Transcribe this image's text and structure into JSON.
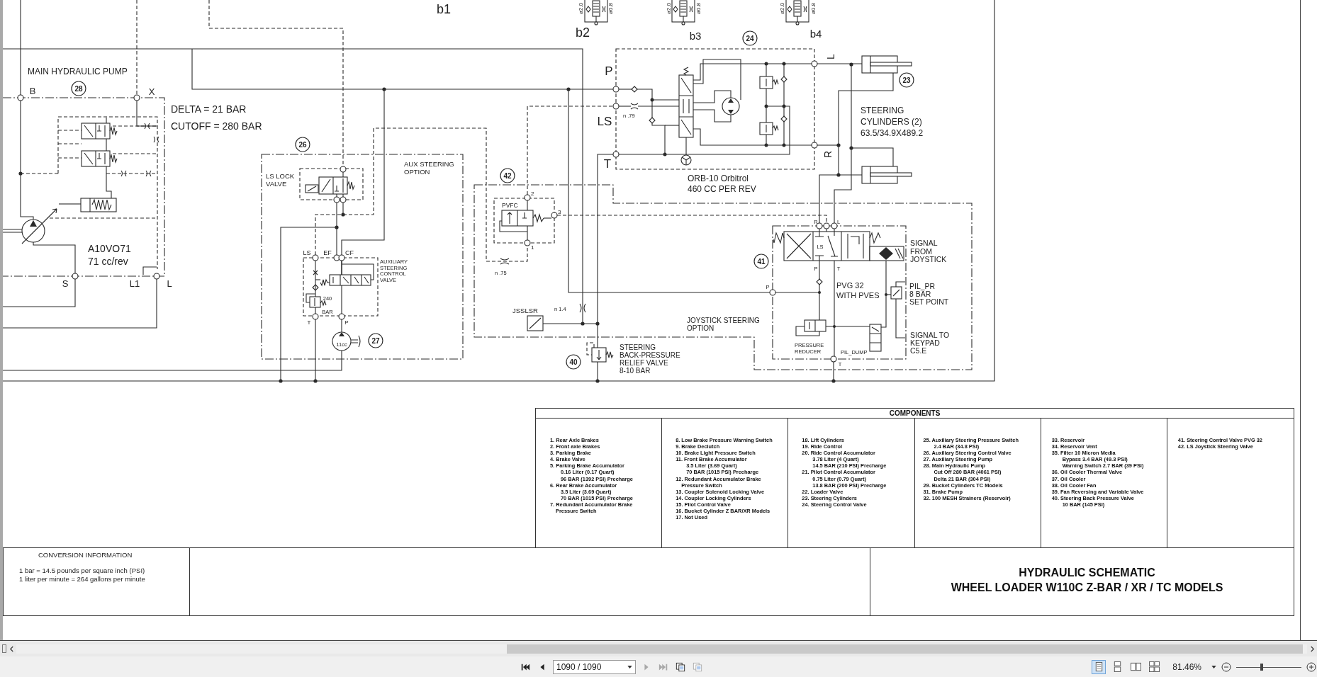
{
  "schematic": {
    "labels": [
      {
        "lines": [
          "b1"
        ]
      },
      {
        "lines": [
          "ø2.0"
        ]
      },
      {
        "lines": [
          "ø0.8"
        ]
      },
      {
        "lines": [
          "ø2.0"
        ]
      },
      {
        "lines": [
          "ø0.8"
        ]
      },
      {
        "lines": [
          "ø2.0"
        ]
      },
      {
        "lines": [
          "ø0.8"
        ]
      },
      {
        "lines": [
          "b2"
        ]
      },
      {
        "lines": [
          "b3"
        ]
      },
      {
        "lines": [
          "b4"
        ]
      },
      {
        "lines": [
          "L"
        ]
      },
      {
        "lines": [
          "MAIN HYDRAULIC PUMP"
        ]
      },
      {
        "lines": [
          "P"
        ]
      },
      {
        "lines": [
          "B"
        ]
      },
      {
        "lines": [
          "X"
        ]
      },
      {
        "lines": [
          "DELTA = 21 BAR"
        ]
      },
      {
        "lines": [
          "CUTOFF = 280 BAR"
        ]
      },
      {
        "lines": [
          "LS"
        ]
      },
      {
        "lines": [
          "n .79"
        ]
      },
      {
        "lines": [
          "STEERING",
          "CYLINDERS (2)",
          "63.5/34.9X489.2"
        ]
      },
      {
        "lines": [
          "LS LOCK",
          "VALVE"
        ]
      },
      {
        "lines": [
          "AUX STEERING",
          "OPTION"
        ]
      },
      {
        "lines": [
          "T"
        ]
      },
      {
        "lines": [
          "R"
        ]
      },
      {
        "lines": [
          "2"
        ]
      },
      {
        "lines": [
          "ORB-10 Orbitrol",
          "460 CC PER REV"
        ]
      },
      {
        "lines": [
          "PVFC"
        ]
      },
      {
        "lines": [
          "3"
        ]
      },
      {
        "lines": [
          "R"
        ]
      },
      {
        "lines": [
          "L"
        ]
      },
      {
        "lines": [
          "A10VO71",
          "71 cc/rev"
        ]
      },
      {
        "lines": [
          "LS"
        ]
      },
      {
        "lines": [
          "EF"
        ]
      },
      {
        "lines": [
          "CF"
        ]
      },
      {
        "lines": [
          "1"
        ]
      },
      {
        "lines": [
          "LS"
        ]
      },
      {
        "lines": [
          "S"
        ]
      },
      {
        "lines": [
          "L1"
        ]
      },
      {
        "lines": [
          "L"
        ]
      },
      {
        "lines": [
          "AUXILIARY",
          "STEERING",
          "CONTROL",
          "VALVE"
        ]
      },
      {
        "lines": [
          "SIGNAL",
          "FROM",
          "JOYSTICK"
        ]
      },
      {
        "lines": [
          "n .75"
        ]
      },
      {
        "lines": [
          "P"
        ]
      },
      {
        "lines": [
          "T"
        ]
      },
      {
        "lines": [
          "240"
        ]
      },
      {
        "lines": [
          "P"
        ]
      },
      {
        "lines": [
          "PVG 32",
          "WITH PVES"
        ]
      },
      {
        "lines": [
          "PIL_PR",
          "8 BAR",
          "SET POINT"
        ]
      },
      {
        "lines": [
          "BAR"
        ]
      },
      {
        "lines": [
          "JSSLSR"
        ]
      },
      {
        "lines": [
          "n 1.4"
        ]
      },
      {
        "lines": [
          "T"
        ]
      },
      {
        "lines": [
          "P"
        ]
      },
      {
        "lines": [
          "JOYSTICK STEERING",
          "OPTION"
        ]
      },
      {
        "lines": [
          "STEERING",
          "BACK-PRESSURE",
          "RELIEF VALVE",
          "8-10 BAR"
        ]
      },
      {
        "lines": [
          "PRESSURE",
          "REDUCER"
        ]
      },
      {
        "lines": [
          "PIL_DUMP"
        ]
      },
      {
        "lines": [
          "SIGNAL TO",
          "KEYPAD",
          "C5.E"
        ]
      },
      {
        "lines": [
          "T"
        ]
      }
    ],
    "callouts": [
      "24",
      "28",
      "23",
      "26",
      "42",
      "41",
      "27",
      "40"
    ],
    "aux_pump": {
      "label": "11cc"
    }
  },
  "components": {
    "title": "COMPONENTS",
    "columns": [
      {
        "entries": [
          {
            "lines": [
              "1. Rear Axle Brakes"
            ]
          },
          {
            "lines": [
              "2. Front axle Brakes"
            ]
          },
          {
            "lines": [
              "3. Parking Brake"
            ]
          },
          {
            "lines": [
              "4. Brake Valve"
            ]
          },
          {
            "lines": [
              "5. Parking Brake Accumulator"
            ],
            "children": [
              {
                "lines": [
                  "0.16 Liter (0.17 Quart)"
                ]
              },
              {
                "lines": [
                  "96 BAR (1392 PSI) Precharge"
                ]
              }
            ]
          },
          {
            "lines": [
              "6. Rear Brake Accumulator"
            ],
            "children": [
              {
                "lines": [
                  "3.5 Liter (3.69 Quart)"
                ]
              },
              {
                "lines": [
                  "70 BAR (1015 PSI) Precharge"
                ]
              }
            ]
          },
          {
            "lines": [
              "7. Redundant Accumulator Brake",
              "Pressure Switch"
            ]
          }
        ]
      },
      {
        "entries": [
          {
            "lines": [
              "8. Low Brake Pressure Warning Switch"
            ]
          },
          {
            "lines": [
              "9. Brake Declutch"
            ]
          },
          {
            "lines": [
              "10. Brake Light Pressure Switch"
            ]
          },
          {
            "lines": [
              "11. Front Brake Accumulator"
            ],
            "children": [
              {
                "lines": [
                  "3.5 Liter (3.69 Quart)"
                ]
              },
              {
                "lines": [
                  "70 BAR (1015 PSI) Precharge"
                ]
              }
            ]
          },
          {
            "lines": [
              "12. Redundant Accumulator Brake",
              "Pressure Switch"
            ]
          },
          {
            "lines": [
              "13. Coupler Solenoid Locking Valve"
            ]
          },
          {
            "lines": [
              "14. Coupler Locking Cylinders"
            ]
          },
          {
            "lines": [
              "15. Pilot Control Valve"
            ]
          },
          {
            "lines": [
              "16. Bucket Cylinder Z BAR/XR Models"
            ]
          },
          {
            "lines": [
              "17. Not Used"
            ]
          }
        ]
      },
      {
        "entries": [
          {
            "lines": [
              "18. Lift Cylinders"
            ]
          },
          {
            "lines": [
              "19. Ride Control"
            ]
          },
          {
            "lines": [
              "20. Ride Control Accumulator"
            ],
            "children": [
              {
                "lines": [
                  "3.78 Liter (4 Quart)"
                ]
              },
              {
                "lines": [
                  "14.5 BAR (210 PSI) Precharge"
                ]
              }
            ]
          },
          {
            "lines": [
              "21. Pilot Control Accumulator"
            ],
            "children": [
              {
                "lines": [
                  "0.75 Liter (0.79 Quart)"
                ]
              },
              {
                "lines": [
                  "13.8 BAR (200 PSI) Precharge"
                ]
              }
            ]
          },
          {
            "lines": [
              "22. Loader Valve"
            ]
          },
          {
            "lines": [
              "23. Steering Cylinders"
            ]
          },
          {
            "lines": [
              "24. Steering Control Valve"
            ]
          }
        ]
      },
      {
        "entries": [
          {
            "lines": [
              "25. Auxiliary Steering Pressure Switch"
            ],
            "children": [
              {
                "lines": [
                  "2.4 BAR (34.8 PSI)"
                ]
              }
            ]
          },
          {
            "lines": [
              "26. Auxiliary Steering Control Valve"
            ]
          },
          {
            "lines": [
              "27. Auxiliary Steering Pump"
            ]
          },
          {
            "lines": [
              "28. Main Hydraulic Pump"
            ],
            "children": [
              {
                "lines": [
                  "Cut Off 280 BAR (4061 PSI)"
                ]
              },
              {
                "lines": [
                  "Delta 21 BAR (304 PSI)"
                ]
              }
            ]
          },
          {
            "lines": [
              "29. Bucket Cylinders TC Models"
            ]
          },
          {
            "lines": [
              "31. Brake Pump"
            ]
          },
          {
            "lines": [
              "32. 100 MESH Strainers (Reservoir)"
            ]
          }
        ]
      },
      {
        "entries": [
          {
            "lines": [
              "33. Reservoir"
            ]
          },
          {
            "lines": [
              "34. Reservoir Vent"
            ]
          },
          {
            "lines": [
              "35. Filter 10 Micron Media"
            ],
            "children": [
              {
                "lines": [
                  "Bypass 3.4 BAR (49.3 PSI)"
                ]
              },
              {
                "lines": [
                  "Warning Switch 2.7 BAR (39 PSI)"
                ]
              }
            ]
          },
          {
            "lines": [
              "36. Oil Cooler Thermal Valve"
            ]
          },
          {
            "lines": [
              "37. Oil Cooler"
            ]
          },
          {
            "lines": [
              "38. Oil Cooler Fan"
            ]
          },
          {
            "lines": [
              "39. Fan Reversing and Variable Valve"
            ]
          },
          {
            "lines": [
              "40. Steering Back Pressure Valve"
            ],
            "children": [
              {
                "lines": [
                  "10 BAR (145 PSI)"
                ]
              }
            ]
          }
        ]
      },
      {
        "entries": [
          {
            "lines": [
              "41. Steering Control Valve PVG 32"
            ]
          },
          {
            "lines": [
              "42. LS Joystick Steering Valve"
            ]
          }
        ]
      }
    ]
  },
  "conversion": {
    "title": "CONVERSION INFORMATION",
    "lines": [
      "1 bar = 14.5 pounds per square inch (PSI)",
      "1 liter per minute = 264 gallons per minute"
    ]
  },
  "title_block": {
    "lines": [
      "HYDRAULIC SCHEMATIC",
      "WHEEL LOADER W110C Z-BAR / XR / TC MODELS"
    ]
  },
  "viewer": {
    "nav_buttons": [
      {
        "kind": "first",
        "disabled": false
      },
      {
        "kind": "previous",
        "disabled": false
      },
      {
        "kind": "next",
        "disabled": true
      },
      {
        "kind": "last",
        "disabled": true
      }
    ],
    "page_field": "1090 / 1090",
    "page_tools": [
      {
        "disabled": false
      },
      {
        "disabled": true
      }
    ],
    "view_modes": [
      {
        "kind": "single",
        "selected": true
      },
      {
        "kind": "continuous",
        "selected": false
      },
      {
        "kind": "facing",
        "selected": false
      },
      {
        "kind": "facing-continuous",
        "selected": false
      }
    ],
    "zoom_value": "81.46%",
    "zoom_slider": {
      "level": 0.39
    }
  }
}
